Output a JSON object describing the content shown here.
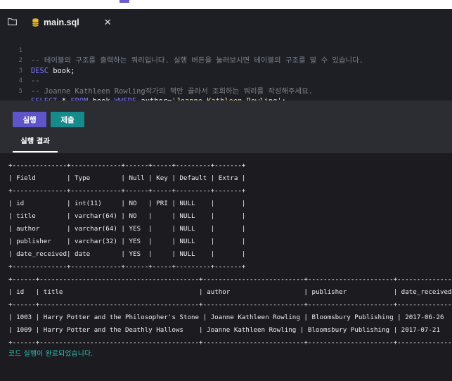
{
  "tab": {
    "title": "main.sql"
  },
  "icons": {
    "folder": "folder-icon",
    "database": "database-icon",
    "close": "close-icon"
  },
  "code_lines": [
    {
      "n": "1",
      "text": "-- 테이블의 구조를 출력하는 쿼리입니다. 실행 버튼을 눌러보시면 테이블의 구조를 알 수 있습니다.",
      "kind": "comment"
    },
    {
      "n": "2",
      "parts": [
        "DESC",
        " book;"
      ]
    },
    {
      "n": "3",
      "text": "--",
      "kind": "comment"
    },
    {
      "n": "4",
      "text": "-- Joanne Kathleen Rowling작가의 책만 골라서 조회하는 쿼리를 작성해주세요.",
      "kind": "comment"
    },
    {
      "n": "5",
      "parts": [
        "SELECT",
        " * ",
        "FROM",
        " book ",
        "WHERE",
        " author=",
        "'Joanne Kathleen Rowling'",
        ";"
      ]
    }
  ],
  "toolbar": {
    "run_label": "실행",
    "submit_label": "제출"
  },
  "result_tab": {
    "label": "실행 결과"
  },
  "output": {
    "lines": [
      "+--------------+-------------+------+-----+---------+-------+",
      "| Field        | Type        | Null | Key | Default | Extra |",
      "+--------------+-------------+------+-----+---------+-------+",
      "| id           | int(11)     | NO   | PRI | NULL    |       |",
      "| title        | varchar(64) | NO   |     | NULL    |       |",
      "| author       | varchar(64) | YES  |     | NULL    |       |",
      "| publisher    | varchar(32) | YES  |     | NULL    |       |",
      "| date_received| date        | YES  |     | NULL    |       |",
      "+--------------+-------------+------+-----+---------+-------+",
      "+------+-----------------------------------------+--------------------------+----------------------+---------------+",
      "| id   | title                                   | author                   | publisher            | date_received |",
      "+------+-----------------------------------------+--------------------------+----------------------+---------------+",
      "| 1003 | Harry Potter and the Philosopher's Stone | Joanne Kathleen Rowling | Bloomsbury Publishing | 2017-06-26    |",
      "| 1009 | Harry Potter and the Deathly Hallows    | Joanne Kathleen Rowling | Bloomsbury Publishing | 2017-07-21    |",
      "+------+-----------------------------------------+--------------------------+----------------------+---------------+"
    ],
    "status": "코드 실행이 완료되었습니다."
  }
}
